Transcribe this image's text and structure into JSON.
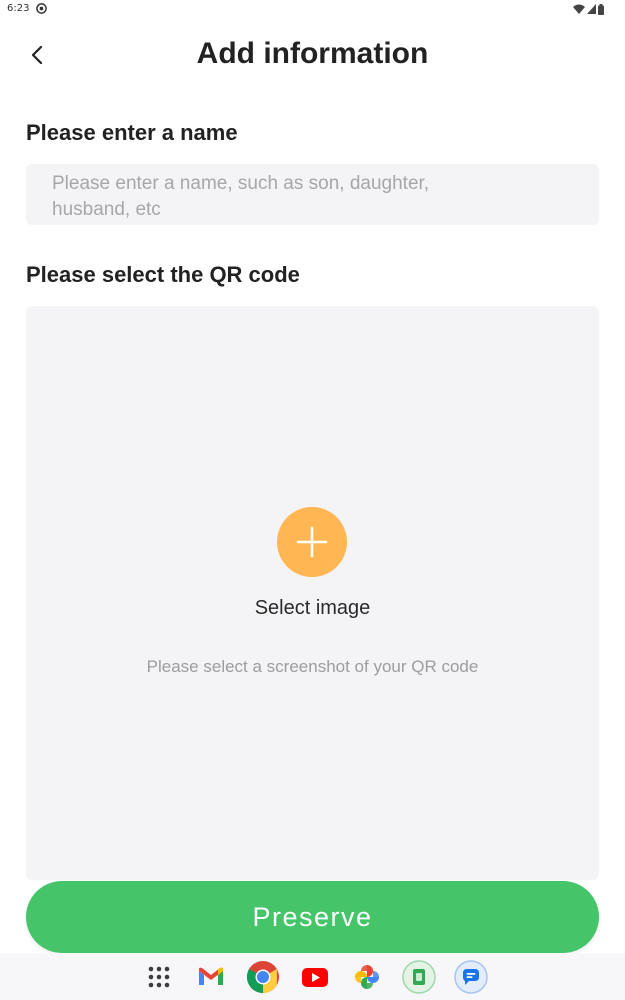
{
  "status_bar": {
    "time": "6:23"
  },
  "header": {
    "title": "Add information",
    "back_icon": "chevron-left-icon"
  },
  "name_section": {
    "label": "Please enter a name",
    "placeholder_line1": "Please enter a name, such as son, daughter,",
    "placeholder_line2": "husband, etc"
  },
  "qr_section": {
    "label": "Please select the QR code",
    "add_icon": "plus-icon",
    "select_label": "Select image",
    "hint": "Please select a screenshot of your QR code"
  },
  "actions": {
    "preserve_label": "Preserve"
  },
  "dock": {
    "items": [
      "app-drawer-icon",
      "gmail-icon",
      "chrome-icon",
      "youtube-icon",
      "photos-icon",
      "files-icon",
      "messages-icon"
    ]
  },
  "colors": {
    "accent_orange": "#ffb653",
    "primary_green": "#45c46a",
    "field_background": "#f4f4f6",
    "placeholder_text": "#a6a6ab"
  }
}
